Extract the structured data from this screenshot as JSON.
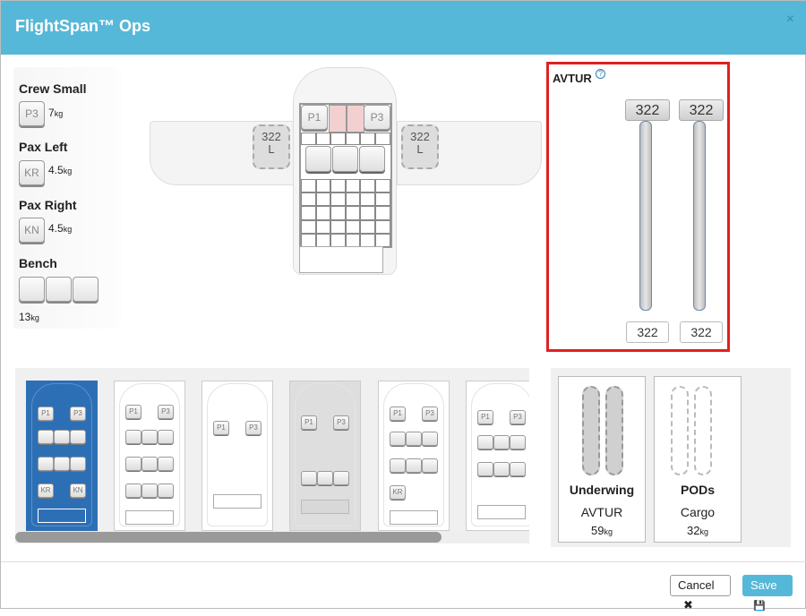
{
  "window": {
    "title": "FlightSpan™ Ops",
    "close_icon": "×"
  },
  "left_panel": {
    "crew_small": {
      "label": "Crew Small",
      "seat": "P3",
      "weight": "7",
      "unit": "kg"
    },
    "pax_left": {
      "label": "Pax Left",
      "seat": "KR",
      "weight": "4.5",
      "unit": "kg"
    },
    "pax_right": {
      "label": "Pax Right",
      "seat": "KN",
      "weight": "4.5",
      "unit": "kg"
    },
    "bench": {
      "label": "Bench",
      "weight": "13",
      "unit": "kg"
    }
  },
  "aircraft": {
    "left_tank": {
      "value": "322",
      "side": "L"
    },
    "right_tank": {
      "value": "322",
      "side": "L"
    },
    "seat_p1": "P1",
    "seat_p3": "P3"
  },
  "fuel": {
    "title": "AVTUR",
    "help_icon": "?",
    "left": {
      "handle": "322",
      "input": "322",
      "level": 1.0
    },
    "right": {
      "handle": "322",
      "input": "322",
      "level": 1.0
    }
  },
  "configs": {
    "card1": {
      "p1": "P1",
      "p3": "P3",
      "kr": "KR",
      "kn": "KN"
    },
    "card2": {
      "p1": "P1",
      "p3": "P3"
    },
    "card3": {
      "p1": "P1",
      "p3": "P3"
    },
    "card4": {
      "p1": "P1",
      "p3": "P3"
    },
    "card5": {
      "p1": "P1",
      "p3": "P3",
      "kr": "KR"
    },
    "card6": {
      "p1": "P1",
      "p3": "P3"
    }
  },
  "external": {
    "underwing": {
      "name": "Underwing",
      "fuel": "AVTUR",
      "weight": "59",
      "unit": "kg"
    },
    "pods": {
      "name": "PODs",
      "cargo": "Cargo",
      "weight": "32",
      "unit": "kg"
    }
  },
  "footer": {
    "cancel_label": "Cancel",
    "cancel_icon": "✖",
    "save_label": "Save",
    "save_icon": "💾"
  }
}
